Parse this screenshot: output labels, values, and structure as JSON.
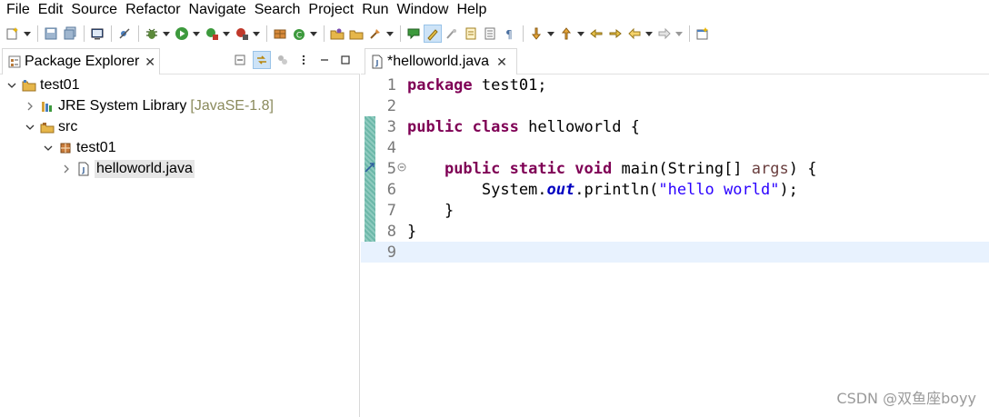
{
  "menu": [
    "File",
    "Edit",
    "Source",
    "Refactor",
    "Navigate",
    "Search",
    "Project",
    "Run",
    "Window",
    "Help"
  ],
  "toolbar": {
    "icons": [
      "new-icon",
      "save-icon",
      "save-all-icon",
      "terminal-icon",
      "skip-breakpoints-icon",
      "debug-icon",
      "run-icon",
      "coverage-icon",
      "external-tools-icon",
      "new-java-project-icon",
      "new-java-class-icon",
      "open-type-icon",
      "open-task-icon",
      "search-icon",
      "toggle-mark-occurrences-icon",
      "highlight-icon",
      "next-annotation-icon",
      "previous-annotation-icon",
      "back-icon",
      "forward-icon",
      "open-perspective-icon"
    ]
  },
  "package_explorer": {
    "title": "Package Explorer",
    "tree": [
      {
        "label": "test01",
        "decoration": "",
        "icon": "project-icon",
        "expanded": true,
        "depth": 0
      },
      {
        "label": "JRE System Library",
        "decoration": "[JavaSE-1.8]",
        "icon": "library-icon",
        "expanded": false,
        "depth": 1
      },
      {
        "label": "src",
        "decoration": "",
        "icon": "source-folder-icon",
        "expanded": true,
        "depth": 1
      },
      {
        "label": "test01",
        "decoration": "",
        "icon": "package-icon",
        "expanded": true,
        "depth": 2
      },
      {
        "label": "helloworld.java",
        "decoration": "",
        "icon": "java-file-icon",
        "expanded": false,
        "depth": 3
      }
    ]
  },
  "editor": {
    "tab_title": "*helloworld.java",
    "current_line": 9,
    "lines": [
      {
        "no": "1",
        "text": "package test01;"
      },
      {
        "no": "2",
        "text": ""
      },
      {
        "no": "3",
        "text": "public class helloworld {"
      },
      {
        "no": "4",
        "text": ""
      },
      {
        "no": "5",
        "text": "    public static void main(String[] args) {"
      },
      {
        "no": "6",
        "text": "        System.out.println(\"hello world\");"
      },
      {
        "no": "7",
        "text": "    }"
      },
      {
        "no": "8",
        "text": "}"
      },
      {
        "no": "9",
        "text": ""
      }
    ]
  },
  "watermark": "CSDN @双鱼座boyy"
}
